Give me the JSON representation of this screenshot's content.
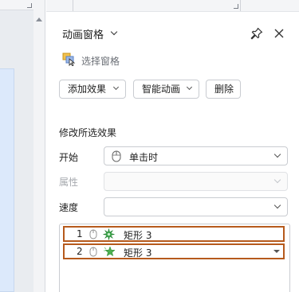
{
  "pane": {
    "title": "动画窗格",
    "selection_pane_label": "选择窗格"
  },
  "toolbar": {
    "add_effect_label": "添加效果",
    "smart_animation_label": "智能动画",
    "delete_label": "删除"
  },
  "modify": {
    "section_title": "修改所选效果",
    "start_label": "开始",
    "start_value": "单击时",
    "property_label": "属性",
    "property_value": "",
    "speed_label": "速度",
    "speed_value": ""
  },
  "animations": [
    {
      "order": "1",
      "name": "矩形 3",
      "effect_icon": "burst-emphasis-icon"
    },
    {
      "order": "2",
      "name": "矩形 3",
      "effect_icon": "star-entrance-icon"
    }
  ],
  "colors": {
    "highlight_border": "#b65a1c",
    "burst_effect": "#2e9e3e",
    "star_effect": "#4caf50",
    "slide_background": "#dce9fb"
  }
}
